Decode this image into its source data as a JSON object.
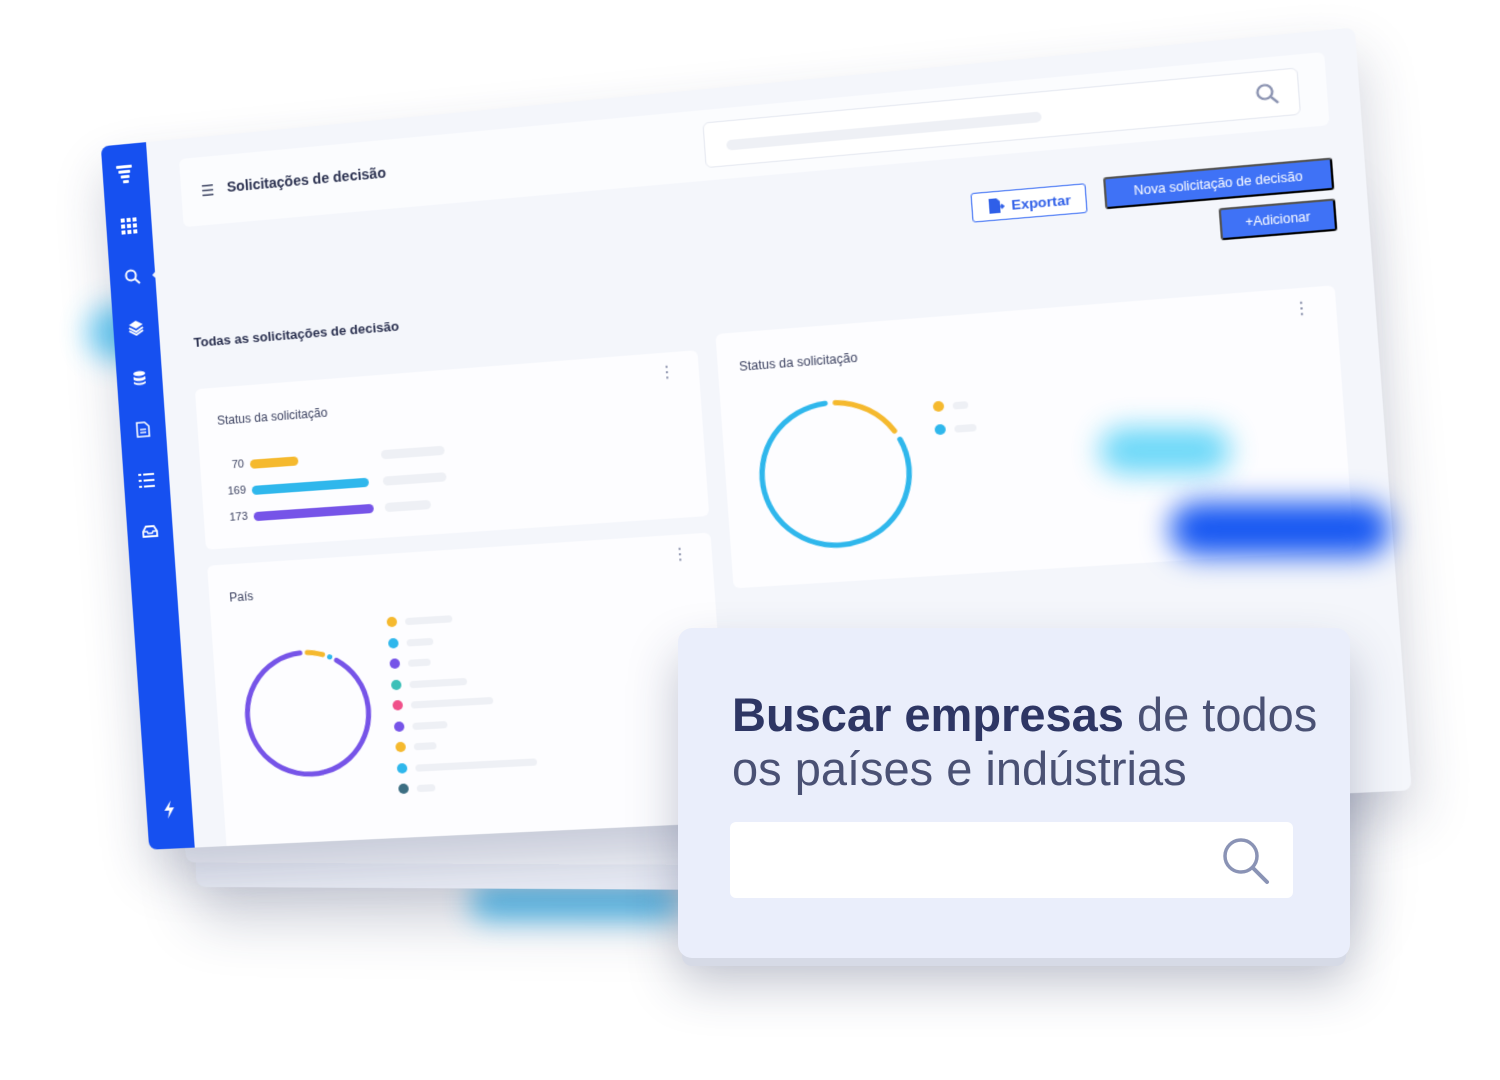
{
  "header": {
    "title": "Solicitações de decisão"
  },
  "actions": {
    "export_label": "Exportar",
    "new_label": "Nova solicitação de decisão",
    "add_label": "+Adicionar"
  },
  "section_title": "Todas as solicitações de decisão",
  "sidebar": {
    "items": [
      {
        "icon": "logo-icon"
      },
      {
        "icon": "grid-icon"
      },
      {
        "icon": "search-icon"
      },
      {
        "icon": "layers-icon"
      },
      {
        "icon": "database-icon"
      },
      {
        "icon": "document-icon"
      },
      {
        "icon": "list-icon"
      },
      {
        "icon": "inbox-icon"
      },
      {
        "icon": "bolt-icon"
      }
    ]
  },
  "cards": {
    "status_bars": {
      "title": "Status da solicitação",
      "bars": [
        {
          "value": "70",
          "color": "#f5b92e",
          "fraction": 0.31
        },
        {
          "value": "169",
          "color": "#2fb7ec",
          "fraction": 0.75
        },
        {
          "value": "173",
          "color": "#7654e8",
          "fraction": 0.77
        }
      ]
    },
    "status_donut": {
      "title": "Status da solicitação",
      "segments": [
        {
          "color": "#f5b92e",
          "fraction": 0.17
        },
        {
          "color": "#2fb7ec",
          "fraction": 0.83
        }
      ]
    },
    "country": {
      "title": "País",
      "segments": [
        {
          "color": "#f5b92e",
          "fraction": 0.06
        },
        {
          "color": "#2fb7ec",
          "fraction": 0.02
        },
        {
          "color": "#7654e8",
          "fraction": 0.92
        }
      ],
      "legend_colors": [
        "#f5b92e",
        "#2fb7ec",
        "#7654e8",
        "#3cc0b8",
        "#f0508a",
        "#7654e8",
        "#f5b92e",
        "#2fb7ec",
        "#3c6e82"
      ]
    }
  },
  "overlay": {
    "headline_bold": "Buscar empresas",
    "headline_rest": " de todos os países e indústrias"
  },
  "colors": {
    "brand": "#1650f0",
    "button": "#3f72f6"
  }
}
